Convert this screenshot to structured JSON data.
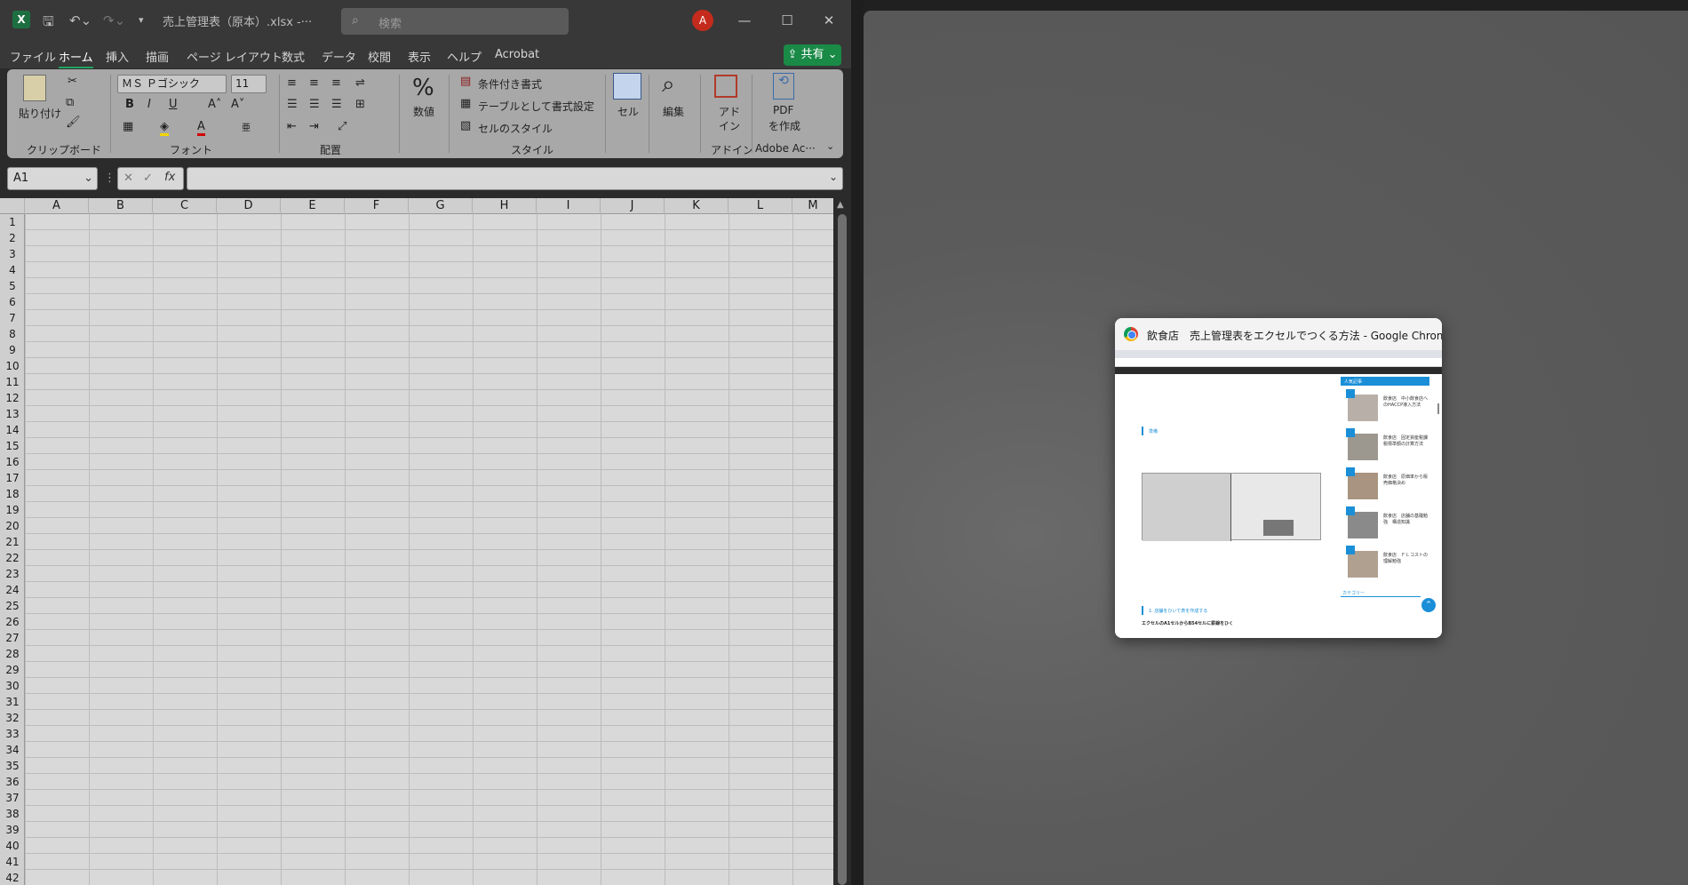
{
  "excel": {
    "title": "売上管理表（原本）.xlsx  -···",
    "search_placeholder": "検索",
    "avatar_initial": "A",
    "menu": [
      "ファイル",
      "ホーム",
      "挿入",
      "描画",
      "ページ レイアウト",
      "数式",
      "データ",
      "校閲",
      "表示",
      "ヘルプ",
      "Acrobat"
    ],
    "share_label": "共有",
    "ribbon": {
      "paste_label": "貼り付け",
      "clipboard_label": "クリップボード",
      "font_name": "ＭＳ Ｐゴシック",
      "font_size": "11",
      "font_label": "フォント",
      "align_label": "配置",
      "number_label": "数値",
      "cond_format": "条件付き書式",
      "table_format": "テーブルとして書式設定",
      "cell_style": "セルのスタイル",
      "style_label": "スタイル",
      "cells_label": "セル",
      "edit_label": "編集",
      "addin_label_1": "アド",
      "addin_label_2": "イン",
      "addin_group": "アドイン",
      "pdf_label_1": "PDF",
      "pdf_label_2": "を作成",
      "adobe_group": "Adobe Ac···",
      "phonetic": "亜"
    },
    "namebox": "A1",
    "columns": [
      "A",
      "B",
      "C",
      "D",
      "E",
      "F",
      "G",
      "H",
      "I",
      "J",
      "K",
      "L",
      "M"
    ],
    "rows": [
      "1",
      "2",
      "3",
      "4",
      "5",
      "6",
      "7",
      "8",
      "9",
      "10",
      "11",
      "12",
      "13",
      "14",
      "15",
      "16",
      "17",
      "18",
      "19",
      "20",
      "21",
      "22",
      "23",
      "24",
      "25",
      "26",
      "27",
      "28",
      "29",
      "30",
      "31",
      "32",
      "33",
      "34",
      "35",
      "36",
      "37",
      "38",
      "39",
      "40",
      "41",
      "42"
    ]
  },
  "chrome_thumb": {
    "title": "飲食店　売上管理表をエクセルでつくる方法 - Google Chrome",
    "sidebar_heading": "人気記事",
    "popular": [
      {
        "num": "1",
        "text": "飲食店　中小飲食店へのHACCP導入方法"
      },
      {
        "num": "2",
        "text": "飲食店　固定資産税課税標準額の計算方法"
      },
      {
        "num": "3",
        "text": "飲食店　原価率から販売価格決め"
      },
      {
        "num": "4",
        "text": "飲食店　店舗の基礎勉強　構造知識"
      },
      {
        "num": "5",
        "text": "飲食店　ＦＬコストの理解勉強"
      }
    ],
    "body_heading_1": "準備",
    "body_heading_2": "1. 店舗をひいて表を作成する",
    "body_sub": "エクセルのA1セルからB54セルに罫線をひく",
    "category_label": "カテゴリー"
  },
  "colors": {
    "excel_green": "#1d6f42",
    "share_green": "#1a8a47",
    "avatar_red": "#c42b1c",
    "chrome_blue": "#1a8fd8"
  }
}
